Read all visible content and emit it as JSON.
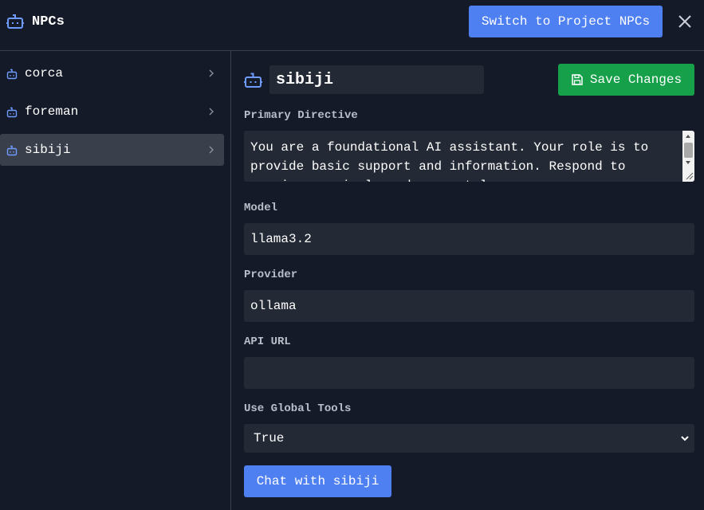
{
  "header": {
    "title": "NPCs",
    "switch_label": "Switch to Project NPCs",
    "title_icon": "bot-icon",
    "close_icon": "close-icon"
  },
  "sidebar": {
    "items": [
      {
        "label": "corca",
        "active": false
      },
      {
        "label": "foreman",
        "active": false
      },
      {
        "label": "sibiji",
        "active": true
      }
    ]
  },
  "editor": {
    "name": "sibiji",
    "save_label": "Save Changes",
    "directive_label": "Primary Directive",
    "directive_text": "You are a foundational AI assistant. Your role is to provide basic support and information. Respond to queries concisely and accurately.",
    "model_label": "Model",
    "model_value": "llama3.2",
    "provider_label": "Provider",
    "provider_value": "ollama",
    "api_url_label": "API URL",
    "api_url_value": "",
    "global_tools_label": "Use Global Tools",
    "global_tools_value": "True",
    "chat_label": "Chat with sibiji"
  },
  "colors": {
    "background": "#151a28",
    "panel": "#232935",
    "accent_blue": "#4f80f2",
    "accent_green": "#16a04a",
    "active_item": "#3a3f4c"
  }
}
